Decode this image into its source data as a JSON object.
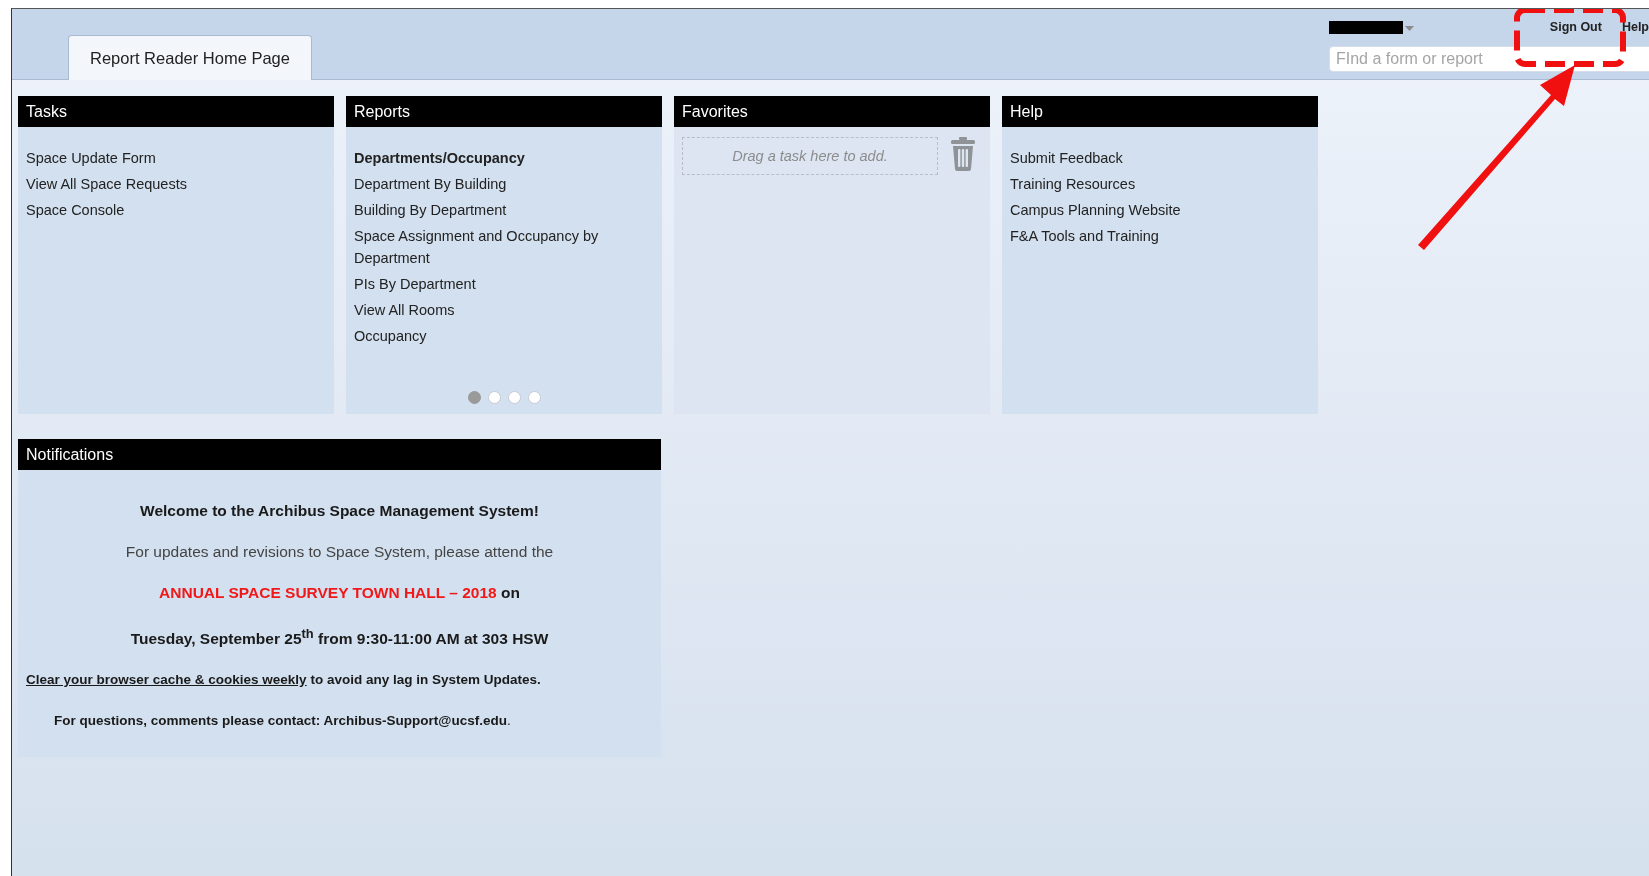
{
  "header": {
    "tab": {
      "label": "Report Reader Home Page",
      "selected": true
    },
    "links": [
      "Sign Out",
      "Help"
    ],
    "search": {
      "placeholder": "FInd a form or report"
    }
  },
  "panels": [
    {
      "title": "Tasks",
      "items": [
        {
          "kind": "link",
          "text": "Space Update Form"
        },
        {
          "kind": "link",
          "text": "View All Space Requests"
        },
        {
          "kind": "link",
          "text": "Space Console"
        }
      ]
    },
    {
      "title": "Reports",
      "items": [
        {
          "kind": "heading",
          "text": "Departments/Occupancy"
        },
        {
          "kind": "link",
          "text": "Department By Building"
        },
        {
          "kind": "link",
          "text": "Building By Department"
        },
        {
          "kind": "link",
          "text": "Space Assignment and Occupancy by Department"
        },
        {
          "kind": "link",
          "text": "PIs By Department"
        },
        {
          "kind": "link",
          "text": "View All Rooms"
        },
        {
          "kind": "link",
          "text": "Occupancy"
        }
      ],
      "pages": [
        {
          "selected": true
        },
        {
          "selected": false
        },
        {
          "selected": false
        },
        {
          "selected": false
        }
      ]
    },
    {
      "title": "Favorites",
      "drop_hint": "Drag a task here to add."
    },
    {
      "title": "Help",
      "items": [
        {
          "kind": "link",
          "text": "Submit Feedback"
        },
        {
          "kind": "link",
          "text": "Training Resources"
        },
        {
          "kind": "link",
          "text": "Campus Planning Website"
        },
        {
          "kind": "link",
          "text": "F&A Tools and Training"
        }
      ]
    }
  ],
  "notifications": {
    "title": "Notifications",
    "lines": [
      {
        "kind": "heading",
        "text": "Welcome to the Archibus Space Management System!"
      },
      {
        "kind": "plain",
        "text": "For updates and revisions to Space System, please attend the"
      },
      {
        "kind": "highlight",
        "highlight": "ANNUAL SPACE SURVEY TOWN HALL – 2018",
        "text": "on"
      },
      {
        "kind": "heading",
        "text": "Tuesday, September 25$^{th}$ from 9:30-11:00 AM at 303 HSW"
      },
      {
        "kind": "link",
        "link": "Clear your browser cache & cookies weekly",
        "text": "to avoid any lag in System Updates."
      },
      {
        "kind": "contact",
        "text": "**For questions, comments please contact: Archibus-Support@ucsf.edu**."
      }
    ]
  }
}
